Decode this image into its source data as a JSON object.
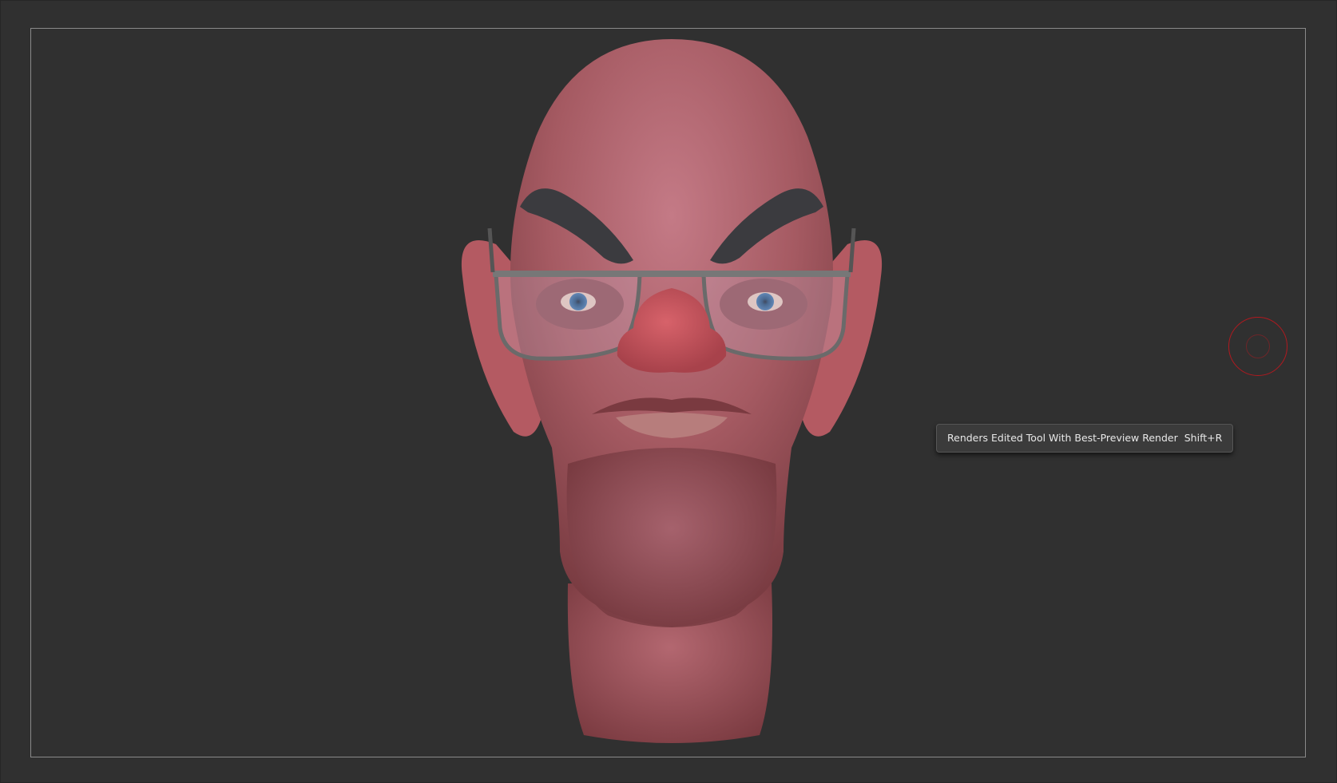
{
  "viewport": {
    "background_color": "#303030",
    "frame_color": "#8a8a8a",
    "model": "sculpted-head-with-glasses"
  },
  "tooltip": {
    "text": "Renders Edited Tool With Best-Preview Render",
    "shortcut": "Shift+R"
  },
  "cursor": {
    "color": "#b0191f",
    "icon": "brush-cursor-icon"
  }
}
